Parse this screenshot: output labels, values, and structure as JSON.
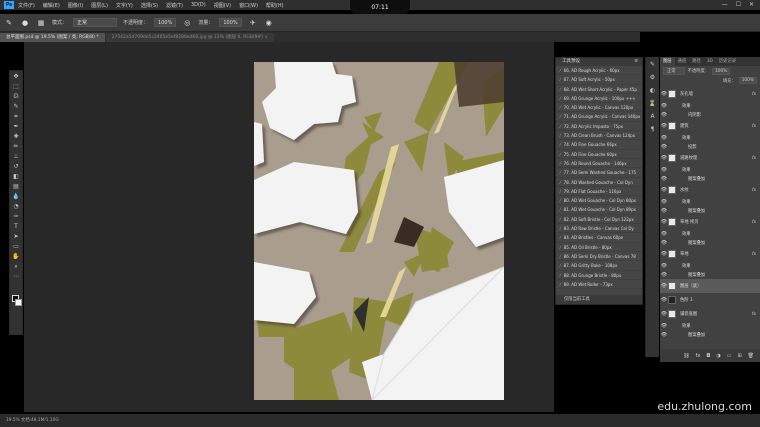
{
  "app": {
    "logo": "Ps",
    "menu": [
      "文件(F)",
      "编辑(E)",
      "图像(I)",
      "图层(L)",
      "文字(Y)",
      "选择(S)",
      "滤镜(T)",
      "3D(D)",
      "视图(V)",
      "窗口(W)",
      "帮助(H)"
    ],
    "clock": "07:11",
    "window_buttons": [
      "—",
      "☐",
      "✕"
    ]
  },
  "options_bar": {
    "mode_label": "模式：",
    "mode_value": "正常",
    "opacity_label": "不透明度：",
    "opacity_value": "100%",
    "flow_label": "流量：",
    "flow_value": "100%"
  },
  "document_tabs": [
    {
      "label": "总平面图.psd @ 19.5% (图案 / 亮, RGB/8) *",
      "active": true
    },
    {
      "label": "27542a5d709de5c2405e5ef8286ed60.jpg @ 12% (图层 0, RGB/8#) ×",
      "active": false
    }
  ],
  "tools": [
    "move-icon",
    "marquee-icon",
    "lasso-icon",
    "quick-select-icon",
    "crop-icon",
    "eyedropper-icon",
    "healing-icon",
    "brush-icon",
    "stamp-icon",
    "history-brush-icon",
    "eraser-icon",
    "gradient-icon",
    "blur-icon",
    "dodge-icon",
    "pen-icon",
    "type-icon",
    "path-select-icon",
    "shape-icon",
    "hand-icon",
    "zoom-icon",
    "more-icon"
  ],
  "brush_panel": {
    "title": "工具预设",
    "items": [
      "66. AD Rough Acrylic - 60px",
      "67. AD Soft Acrylic - 50px",
      "68. AD Wet Short Acrylic - Paper 45p",
      "69. AD Grunge Acrylic - 100px +++",
      "70. AD Wet Acrylic - Canvas 120px",
      "71. AD Grunge Acrylic - Canvas 140px",
      "72. AD Acrylic Impasto - 75px",
      "73. AD Clean Brush - Canvas 124px",
      "74. AD Fine Gouache 66px",
      "75. AD Fine Gouache 60px",
      "76. AD Round Gouache - 146px",
      "77. AD Semi Washed Gouache - 175",
      "78. AD Washed Gouache - Col Dyn",
      "79. AD Flat Gouache - 116px",
      "80. AD Wet Gouache - Col Dyn 80px",
      "81. AD Wet Gouache - Col Dyn 89px",
      "82. AD Soft Bristle - Col Dyn 122px",
      "83. AD Raw Bristle - Canvas Col Dy",
      "84. AD Bristles - Canvas 60px",
      "85. AD Oil Bristle - 80px",
      "86. AD Semi Dry Bristle - Canvas 78",
      "87. AD Gritty Bake - 108px",
      "88. AD Grunge Bristle - 80px",
      "89. AD Wet Roller - 73px"
    ],
    "footer": "仅限当前工具"
  },
  "layers_panel": {
    "tabs": [
      "图层",
      "通道",
      "路径",
      "3D",
      "历史记录"
    ],
    "blend_mode": "正常",
    "opacity_label": "不透明度：",
    "opacity_value": "100%",
    "fill_label": "填充：",
    "fill_value": "100%",
    "rows": [
      {
        "name": "灰孔墙",
        "kind": "layer",
        "fx": true
      },
      {
        "name": "效果",
        "kind": "effect-head"
      },
      {
        "name": "内阴影",
        "kind": "effect"
      },
      {
        "name": "建筑",
        "kind": "layer",
        "fx": true
      },
      {
        "name": "效果",
        "kind": "effect-head"
      },
      {
        "name": "投影",
        "kind": "effect"
      },
      {
        "name": "道路纹理",
        "kind": "layer",
        "fx": true
      },
      {
        "name": "效果",
        "kind": "effect-head"
      },
      {
        "name": "图案叠加",
        "kind": "effect"
      },
      {
        "name": "水纹",
        "kind": "layer",
        "fx": true
      },
      {
        "name": "效果",
        "kind": "effect-head"
      },
      {
        "name": "图案叠加",
        "kind": "effect"
      },
      {
        "name": "草地 拷贝",
        "kind": "layer",
        "fx": true
      },
      {
        "name": "效果",
        "kind": "effect-head"
      },
      {
        "name": "图案叠加",
        "kind": "effect"
      },
      {
        "name": "草地",
        "kind": "layer",
        "fx": true
      },
      {
        "name": "效果",
        "kind": "effect-head"
      },
      {
        "name": "图案叠加",
        "kind": "effect"
      },
      {
        "name": "图层（底）",
        "kind": "layer",
        "selected": true
      },
      {
        "name": "色阶 1",
        "kind": "adjustment"
      },
      {
        "name": "铺装底图",
        "kind": "layer",
        "fx": true
      },
      {
        "name": "效果",
        "kind": "effect-head"
      },
      {
        "name": "图案叠加",
        "kind": "effect"
      }
    ],
    "footer_icons": [
      "link-icon",
      "fx-icon",
      "mask-icon",
      "adjust-icon",
      "folder-icon",
      "new-layer-icon",
      "trash-icon"
    ]
  },
  "status_bar": "19.5%    文档:48.1M/1.10G",
  "watermark": "edu.zhulong.com",
  "colors": {
    "grass": "#8e8a3c",
    "ground": "#b3a798",
    "building": "#f2f2f2"
  }
}
